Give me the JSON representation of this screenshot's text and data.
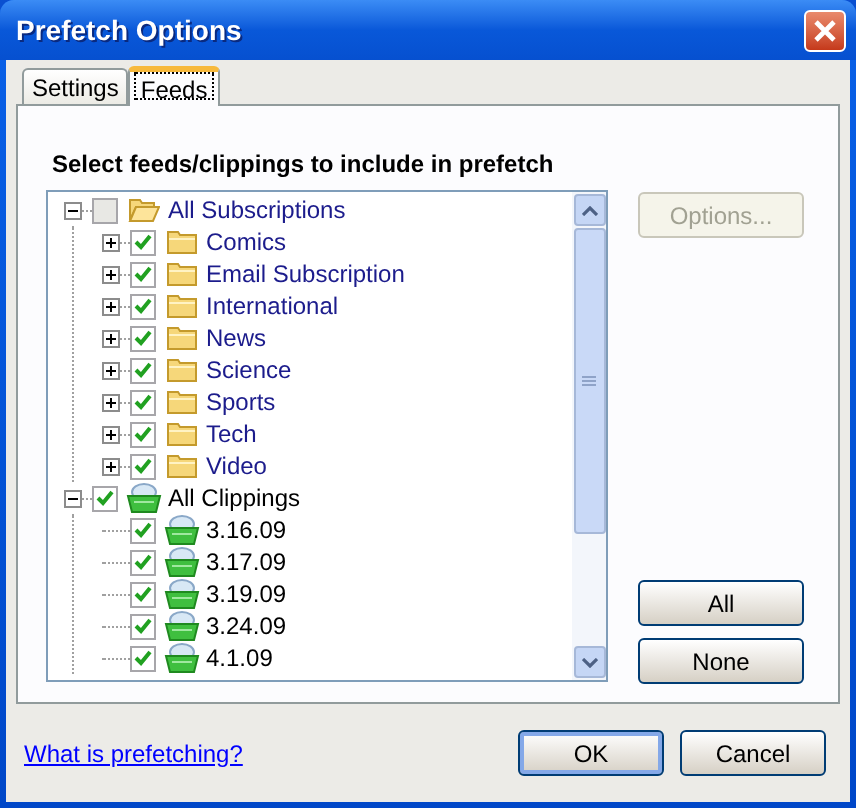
{
  "window": {
    "title": "Prefetch Options"
  },
  "tabs": [
    {
      "label": "Settings",
      "selected": false
    },
    {
      "label": "Feeds",
      "selected": true
    }
  ],
  "heading": "Select feeds/clippings to include in prefetch",
  "tree": [
    {
      "label": "All Subscriptions",
      "kind": "folder",
      "checked": false,
      "expanded": true,
      "children": [
        {
          "label": "Comics",
          "kind": "folder",
          "checked": true,
          "expanded": false
        },
        {
          "label": "Email Subscription",
          "kind": "folder",
          "checked": true,
          "expanded": false
        },
        {
          "label": "International",
          "kind": "folder",
          "checked": true,
          "expanded": false
        },
        {
          "label": "News",
          "kind": "folder",
          "checked": true,
          "expanded": false
        },
        {
          "label": "Science",
          "kind": "folder",
          "checked": true,
          "expanded": false
        },
        {
          "label": "Sports",
          "kind": "folder",
          "checked": true,
          "expanded": false
        },
        {
          "label": "Tech",
          "kind": "folder",
          "checked": true,
          "expanded": false
        },
        {
          "label": "Video",
          "kind": "folder",
          "checked": true,
          "expanded": false
        }
      ]
    },
    {
      "label": "All Clippings",
      "kind": "clipping",
      "checked": true,
      "expanded": true,
      "children": [
        {
          "label": "3.16.09",
          "kind": "clipping",
          "checked": true
        },
        {
          "label": "3.17.09",
          "kind": "clipping",
          "checked": true
        },
        {
          "label": "3.19.09",
          "kind": "clipping",
          "checked": true
        },
        {
          "label": "3.24.09",
          "kind": "clipping",
          "checked": true
        },
        {
          "label": "4.1.09",
          "kind": "clipping",
          "checked": true
        }
      ]
    }
  ],
  "side_buttons": [
    {
      "label": "Options...",
      "disabled": true
    },
    {
      "label": "All",
      "disabled": false
    },
    {
      "label": "None",
      "disabled": false
    }
  ],
  "link": "What is prefetching?",
  "buttons": [
    "OK",
    "Cancel"
  ]
}
